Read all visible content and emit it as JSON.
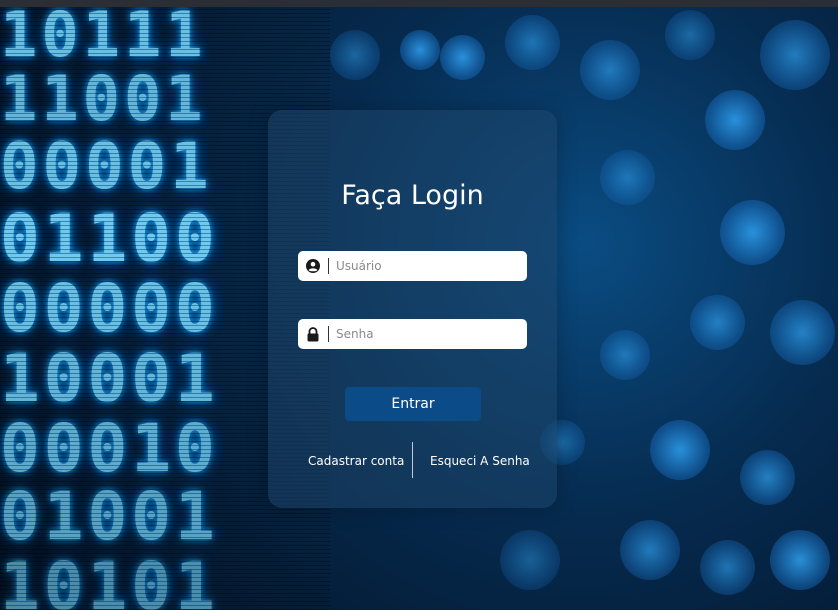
{
  "login": {
    "title": "Faça Login",
    "username": {
      "placeholder": "Usuário",
      "value": "",
      "icon": "user-circle-icon"
    },
    "password": {
      "placeholder": "Senha",
      "value": "",
      "icon": "lock-icon"
    },
    "submit_label": "Entrar",
    "register_link": "Cadastrar conta",
    "forgot_link": "Esqueci A Senha"
  },
  "background": {
    "binary_rows": [
      "10111",
      "11001",
      "00001",
      "01100",
      "00000",
      "10001",
      "00010",
      "01001",
      "10101"
    ]
  },
  "colors": {
    "panel": "#1e4669",
    "button": "#0b4b87",
    "text": "#ffffff",
    "digits": "#7fdcff"
  }
}
